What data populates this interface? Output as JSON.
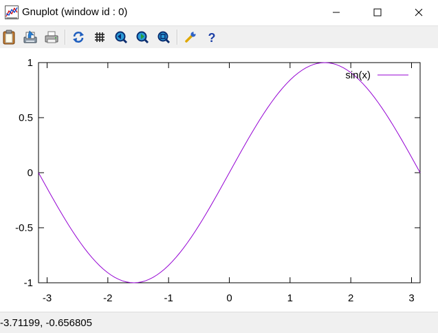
{
  "window": {
    "title": "Gnuplot (window id : 0)",
    "controls": [
      "minimize",
      "maximize",
      "close"
    ]
  },
  "toolbar": {
    "icons": [
      "clipboard-icon",
      "print-icon",
      "printer-icon",
      "replot-icon",
      "grid-icon",
      "zoom-previous-icon",
      "zoom-next-icon",
      "autoscale-icon",
      "options-icon",
      "help-icon"
    ]
  },
  "status": {
    "coordinates": "-3.71199, -0.656805"
  },
  "chart_data": {
    "type": "line",
    "title": "",
    "xlabel": "",
    "ylabel": "",
    "xlim": [
      -3.14159,
      3.14159
    ],
    "ylim": [
      -1,
      1
    ],
    "x_ticks": [
      {
        "value": -3,
        "label": "-3"
      },
      {
        "value": -2,
        "label": "-2"
      },
      {
        "value": -1,
        "label": "-1"
      },
      {
        "value": 0,
        "label": "0"
      },
      {
        "value": 1,
        "label": "1"
      },
      {
        "value": 2,
        "label": "2"
      },
      {
        "value": 3,
        "label": "3"
      }
    ],
    "y_ticks": [
      {
        "value": 1,
        "label": "1"
      },
      {
        "value": 0.5,
        "label": "0.5"
      },
      {
        "value": 0,
        "label": "0"
      },
      {
        "value": -0.5,
        "label": "-0.5"
      },
      {
        "value": -1,
        "label": "-1"
      }
    ],
    "grid": false,
    "legend": "top-right",
    "series": [
      {
        "name": "sin(x)",
        "color": "#9400d3",
        "function": "sin(x)",
        "samples": 100
      }
    ]
  }
}
